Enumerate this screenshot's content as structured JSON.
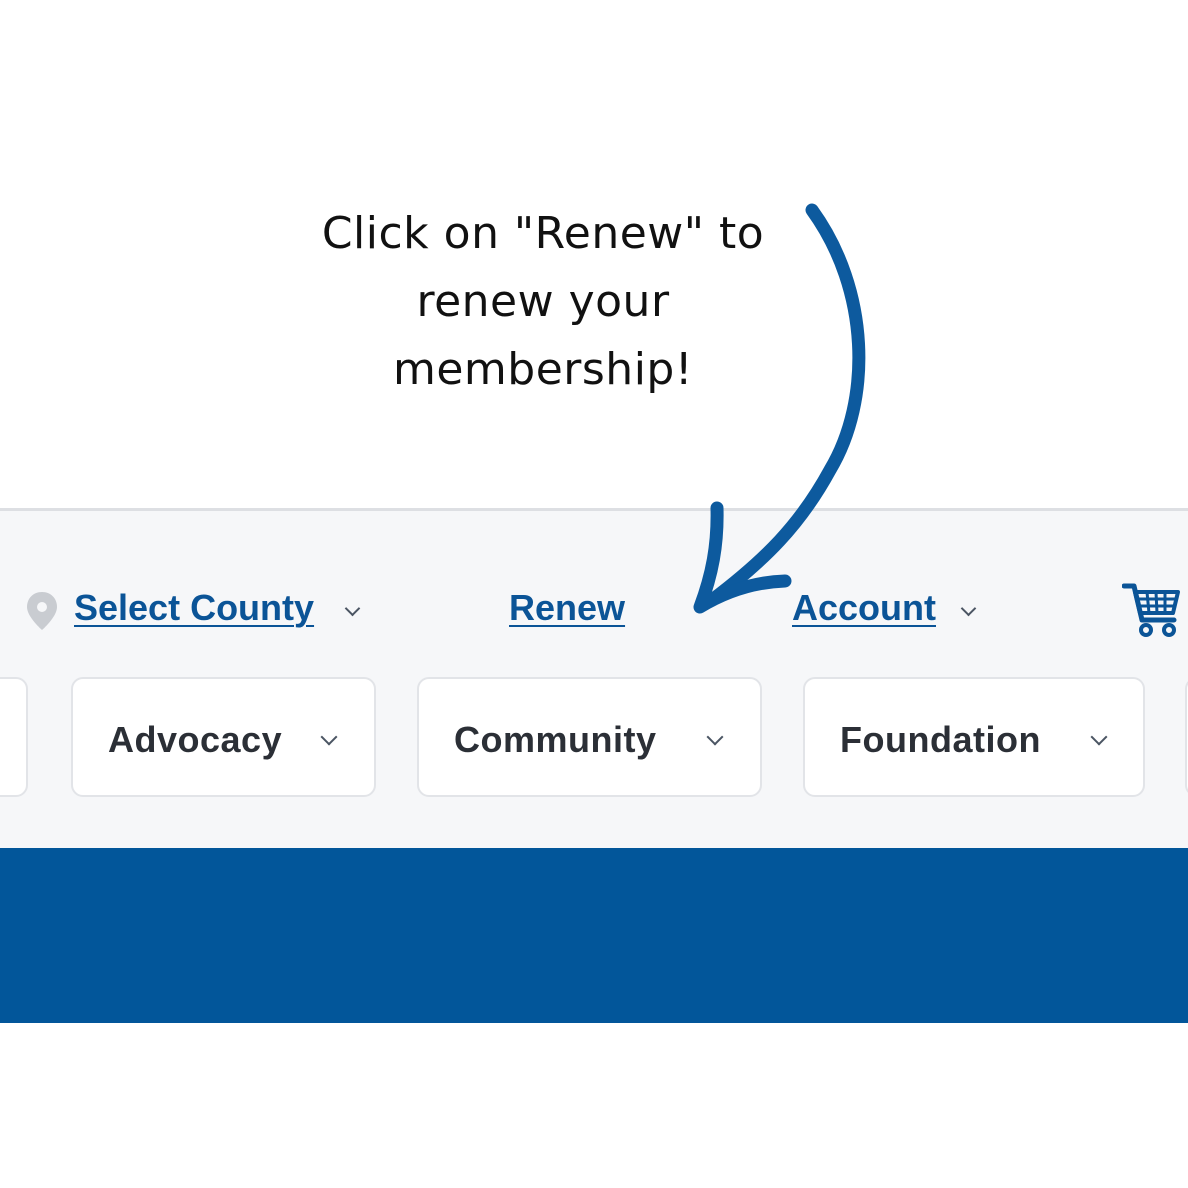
{
  "instruction": {
    "line1": "Click on \"Renew\" to",
    "line2": "renew your",
    "line3": "membership!"
  },
  "utility_nav": {
    "county_label": "Select County",
    "renew_label": "Renew",
    "account_label": "Account"
  },
  "main_nav": {
    "items": [
      {
        "label": "Advocacy"
      },
      {
        "label": "Community"
      },
      {
        "label": "Foundation"
      }
    ]
  },
  "colors": {
    "brand_blue": "#02569a",
    "link_blue": "#0b5497",
    "arrow_blue": "#0d5a9e",
    "header_bg": "#f6f7f9",
    "text_dark": "#2b2f36"
  },
  "icons": [
    "location-pin-icon",
    "chevron-down-icon",
    "shopping-cart-icon",
    "curved-arrow-icon"
  ]
}
